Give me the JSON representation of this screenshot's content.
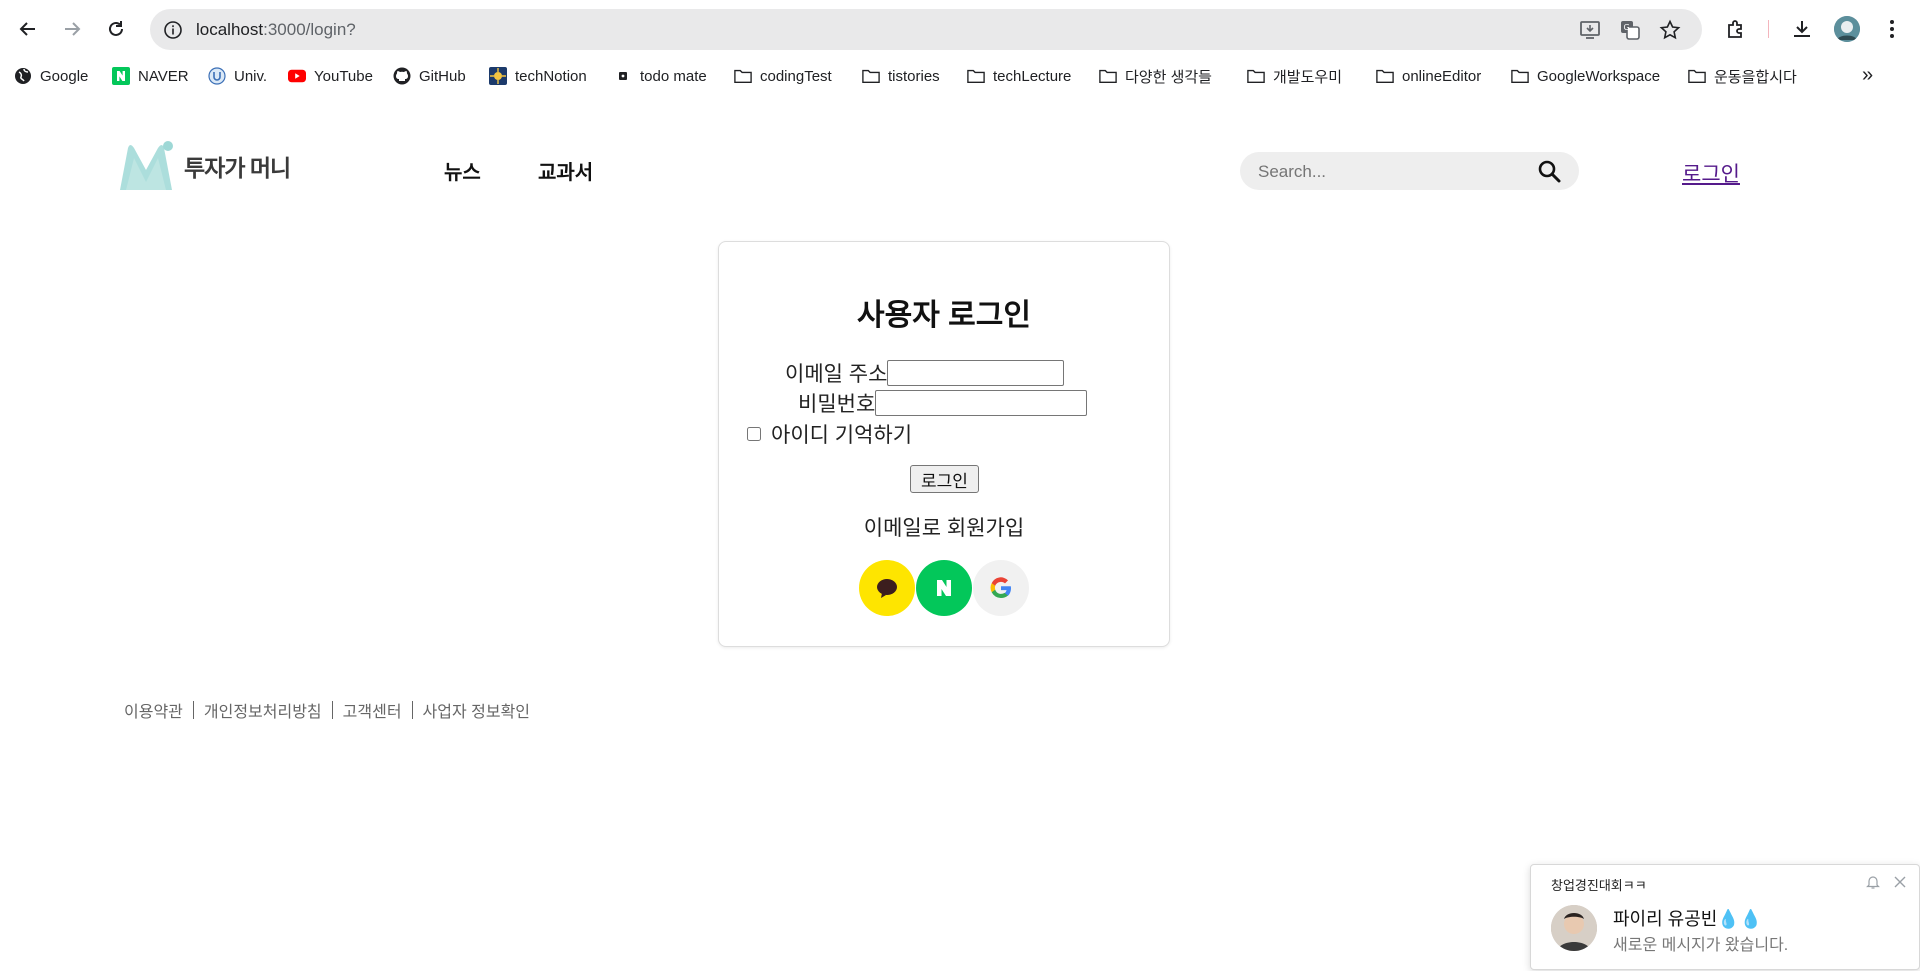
{
  "browser": {
    "url_host": "localhost",
    "url_rest": ":3000/login?",
    "bookmarks": [
      {
        "label": "Google",
        "icon": "google-globe-icon"
      },
      {
        "label": "NAVER",
        "icon": "naver-icon"
      },
      {
        "label": "Univ.",
        "icon": "univ-icon"
      },
      {
        "label": "YouTube",
        "icon": "youtube-icon"
      },
      {
        "label": "GitHub",
        "icon": "github-icon"
      },
      {
        "label": "techNotion",
        "icon": "technotion-icon"
      },
      {
        "label": "todo mate",
        "icon": "todomate-icon"
      },
      {
        "label": "codingTest",
        "icon": "folder-icon"
      },
      {
        "label": "tistories",
        "icon": "folder-icon"
      },
      {
        "label": "techLecture",
        "icon": "folder-icon"
      },
      {
        "label": "다양한 생각들",
        "icon": "folder-icon"
      },
      {
        "label": "개발도우미",
        "icon": "folder-icon"
      },
      {
        "label": "onlineEditor",
        "icon": "folder-icon"
      },
      {
        "label": "GoogleWorkspace",
        "icon": "folder-icon"
      },
      {
        "label": "운동을합시다",
        "icon": "folder-icon"
      }
    ],
    "more_label": "»"
  },
  "header": {
    "logo_text": "투자가 머니",
    "nav": [
      "뉴스",
      "교과서"
    ],
    "search_placeholder": "Search...",
    "login_link": "로그인"
  },
  "login": {
    "title": "사용자 로그인",
    "email_label": "이메일 주소",
    "password_label": "비밀번호",
    "remember_label": "아이디 기억하기",
    "submit_label": "로그인",
    "signup_text": "이메일로 회원가입",
    "social": [
      {
        "name": "kakao",
        "color": "#FEE500"
      },
      {
        "name": "naver",
        "color": "#03C75A"
      },
      {
        "name": "google",
        "color": "#F1F1F1"
      }
    ]
  },
  "footer": {
    "links": [
      "이용약관",
      "개인정보처리방침",
      "고객센터",
      "사업자 정보확인"
    ]
  },
  "notification": {
    "app": "창업경진대회ㅋㅋ",
    "title": "파이리 유공빈💧💧",
    "body": "새로운 메시지가 왔습니다."
  },
  "colors": {
    "link_visited": "#551a8b",
    "kakao": "#FEE500",
    "naver": "#03C75A"
  }
}
